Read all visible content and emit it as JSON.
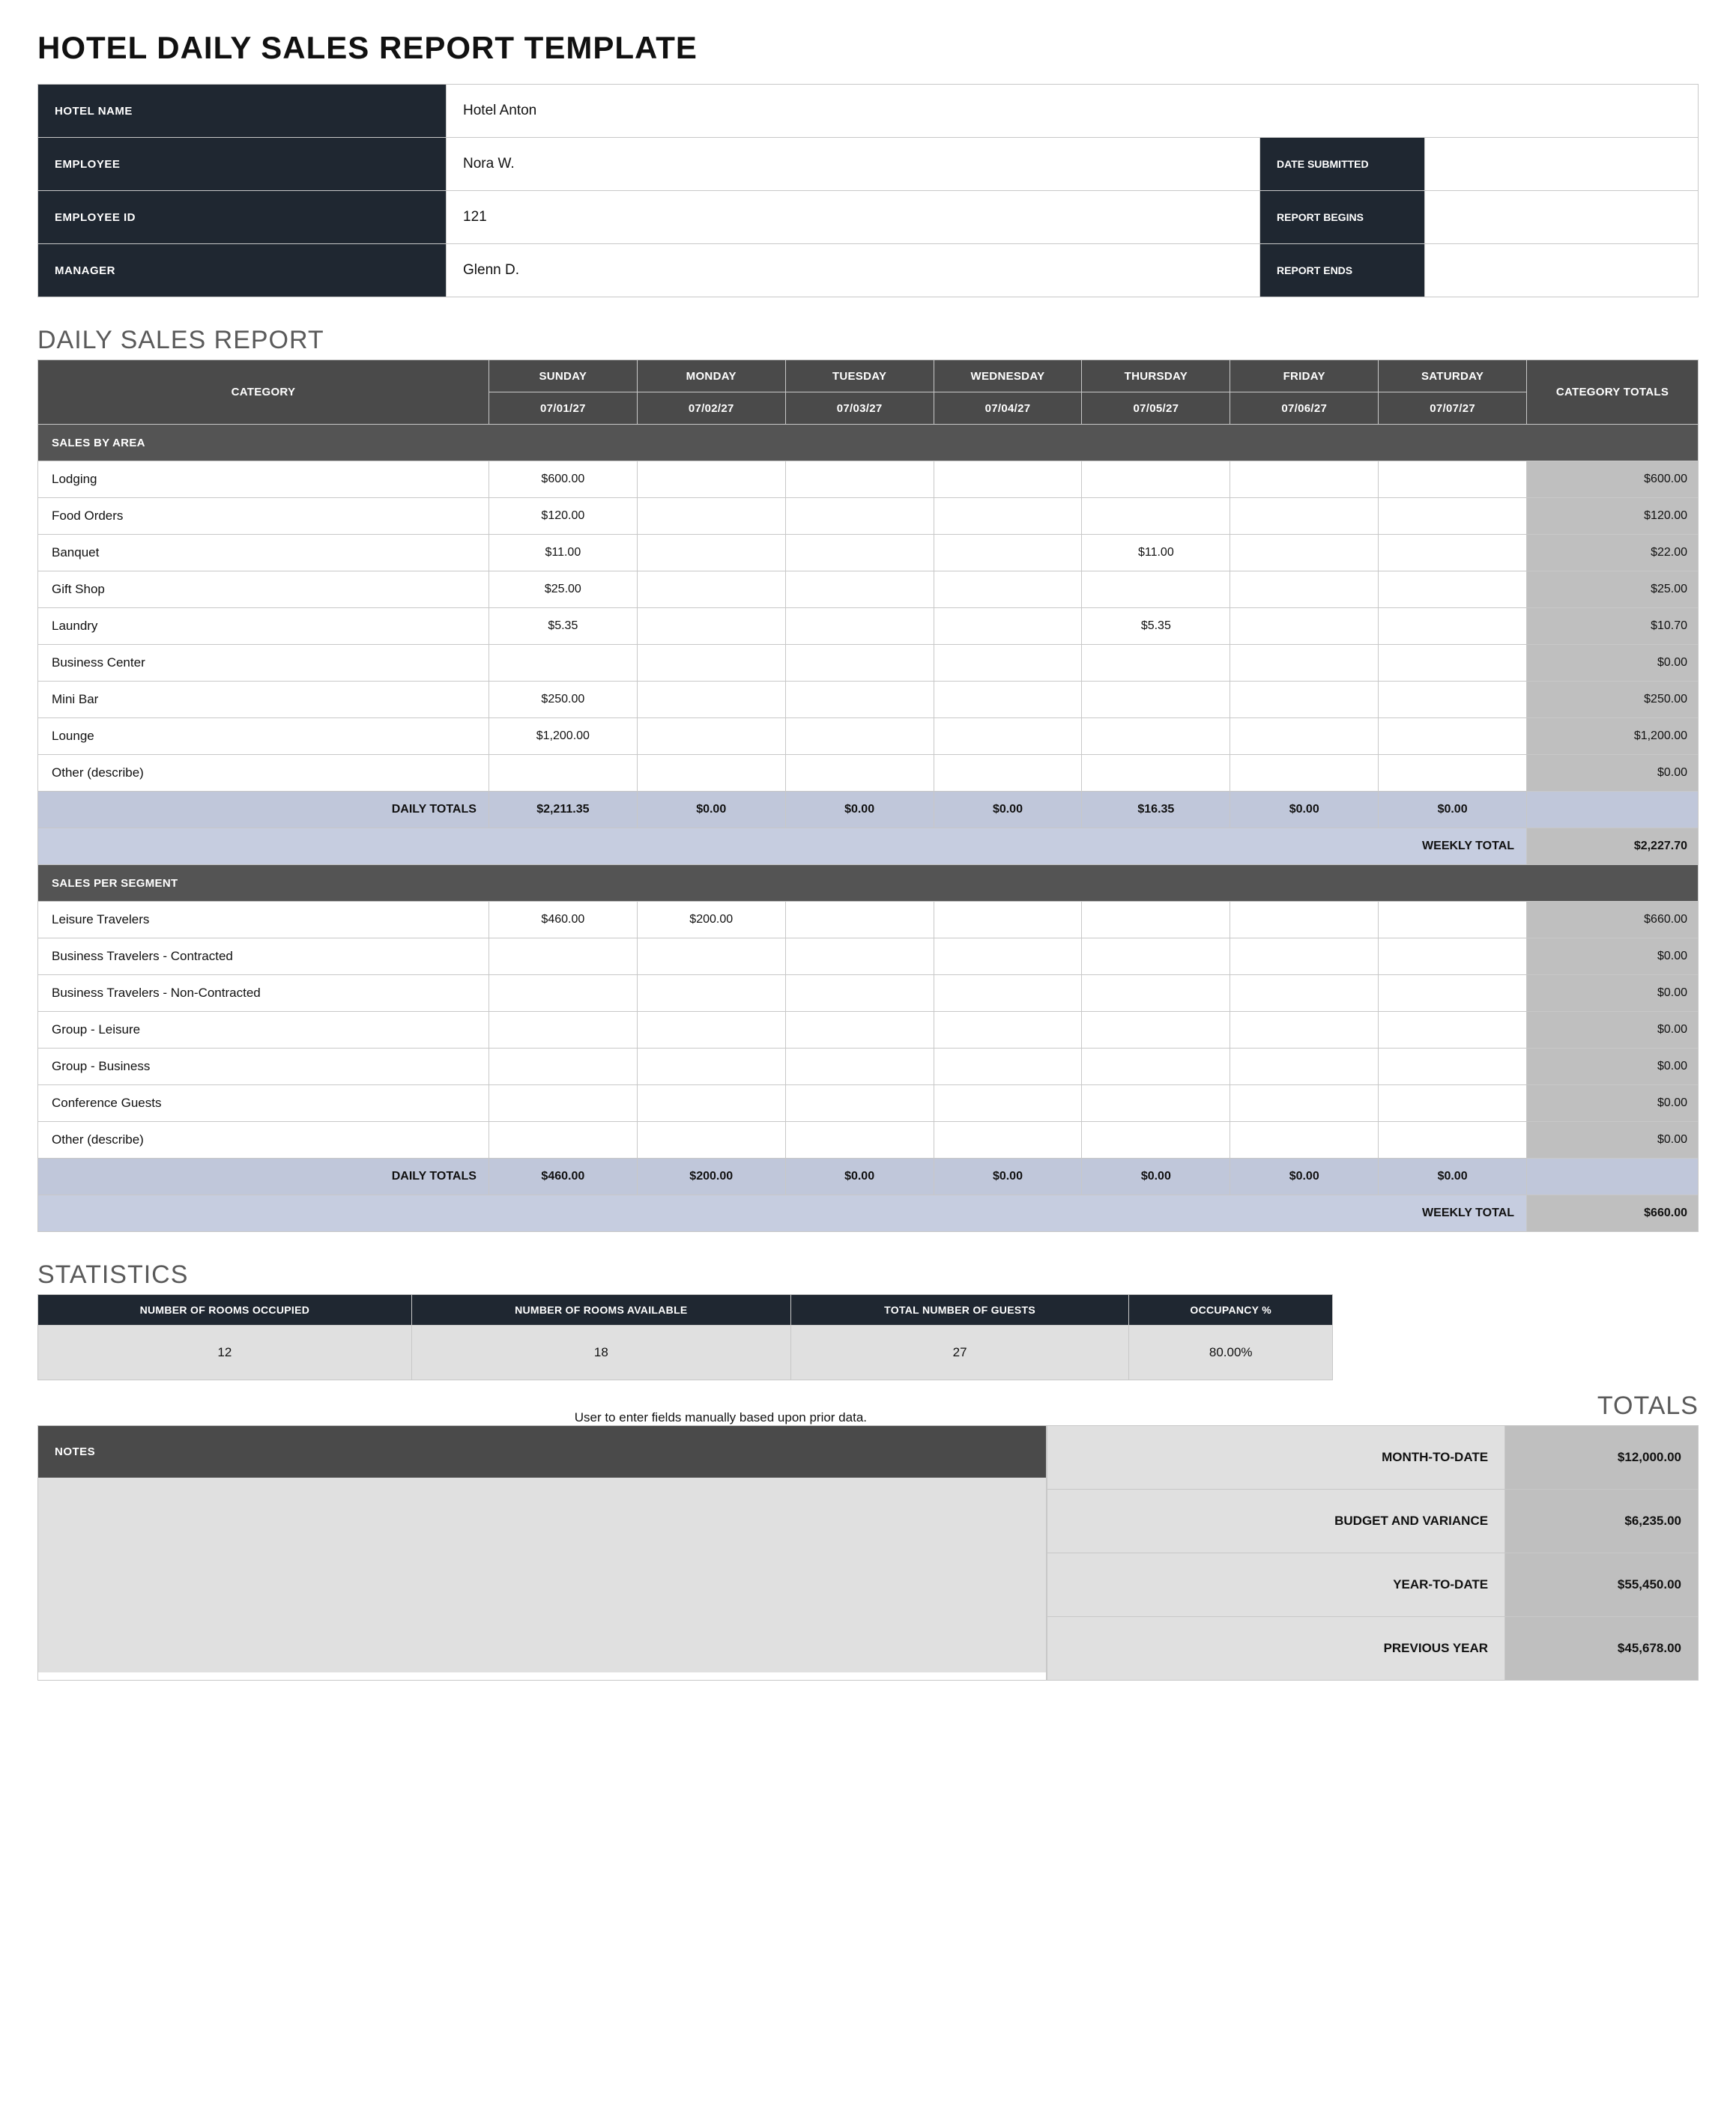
{
  "title": "HOTEL DAILY SALES REPORT TEMPLATE",
  "header": {
    "labels": {
      "hotel_name": "HOTEL NAME",
      "employee": "EMPLOYEE",
      "employee_id": "EMPLOYEE ID",
      "manager": "MANAGER",
      "date_submitted": "DATE SUBMITTED",
      "report_begins": "REPORT BEGINS",
      "report_ends": "REPORT ENDS"
    },
    "values": {
      "hotel_name": "Hotel Anton",
      "employee": "Nora W.",
      "employee_id": "121",
      "manager": "Glenn D.",
      "date_submitted": "",
      "report_begins": "",
      "report_ends": ""
    }
  },
  "report": {
    "section_title": "DAILY SALES REPORT",
    "col_category": "CATEGORY",
    "col_totals": "CATEGORY TOTALS",
    "days": [
      {
        "name": "SUNDAY",
        "date": "07/01/27"
      },
      {
        "name": "MONDAY",
        "date": "07/02/27"
      },
      {
        "name": "TUESDAY",
        "date": "07/03/27"
      },
      {
        "name": "WEDNESDAY",
        "date": "07/04/27"
      },
      {
        "name": "THURSDAY",
        "date": "07/05/27"
      },
      {
        "name": "FRIDAY",
        "date": "07/06/27"
      },
      {
        "name": "SATURDAY",
        "date": "07/07/27"
      }
    ],
    "section1": {
      "label": "SALES BY AREA",
      "rows": [
        {
          "label": "Lodging",
          "vals": [
            "$600.00",
            "",
            "",
            "",
            "",
            "",
            ""
          ],
          "total": "$600.00"
        },
        {
          "label": "Food Orders",
          "vals": [
            "$120.00",
            "",
            "",
            "",
            "",
            "",
            ""
          ],
          "total": "$120.00"
        },
        {
          "label": "Banquet",
          "vals": [
            "$11.00",
            "",
            "",
            "",
            "$11.00",
            "",
            ""
          ],
          "total": "$22.00"
        },
        {
          "label": "Gift Shop",
          "vals": [
            "$25.00",
            "",
            "",
            "",
            "",
            "",
            ""
          ],
          "total": "$25.00"
        },
        {
          "label": "Laundry",
          "vals": [
            "$5.35",
            "",
            "",
            "",
            "$5.35",
            "",
            ""
          ],
          "total": "$10.70"
        },
        {
          "label": "Business Center",
          "vals": [
            "",
            "",
            "",
            "",
            "",
            "",
            ""
          ],
          "total": "$0.00"
        },
        {
          "label": "Mini Bar",
          "vals": [
            "$250.00",
            "",
            "",
            "",
            "",
            "",
            ""
          ],
          "total": "$250.00"
        },
        {
          "label": "Lounge",
          "vals": [
            "$1,200.00",
            "",
            "",
            "",
            "",
            "",
            ""
          ],
          "total": "$1,200.00"
        },
        {
          "label": "Other (describe)",
          "vals": [
            "",
            "",
            "",
            "",
            "",
            "",
            ""
          ],
          "total": "$0.00"
        }
      ],
      "daily_totals_label": "DAILY TOTALS",
      "daily_totals": [
        "$2,211.35",
        "$0.00",
        "$0.00",
        "$0.00",
        "$16.35",
        "$0.00",
        "$0.00"
      ],
      "weekly_label": "WEEKLY TOTAL",
      "weekly_total": "$2,227.70"
    },
    "section2": {
      "label": "SALES PER SEGMENT",
      "rows": [
        {
          "label": "Leisure Travelers",
          "vals": [
            "$460.00",
            "$200.00",
            "",
            "",
            "",
            "",
            ""
          ],
          "total": "$660.00"
        },
        {
          "label": "Business Travelers - Contracted",
          "vals": [
            "",
            "",
            "",
            "",
            "",
            "",
            ""
          ],
          "total": "$0.00"
        },
        {
          "label": "Business Travelers - Non-Contracted",
          "vals": [
            "",
            "",
            "",
            "",
            "",
            "",
            ""
          ],
          "total": "$0.00"
        },
        {
          "label": "Group - Leisure",
          "vals": [
            "",
            "",
            "",
            "",
            "",
            "",
            ""
          ],
          "total": "$0.00"
        },
        {
          "label": "Group - Business",
          "vals": [
            "",
            "",
            "",
            "",
            "",
            "",
            ""
          ],
          "total": "$0.00"
        },
        {
          "label": "Conference Guests",
          "vals": [
            "",
            "",
            "",
            "",
            "",
            "",
            ""
          ],
          "total": "$0.00"
        },
        {
          "label": "Other (describe)",
          "vals": [
            "",
            "",
            "",
            "",
            "",
            "",
            ""
          ],
          "total": "$0.00"
        }
      ],
      "daily_totals_label": "DAILY TOTALS",
      "daily_totals": [
        "$460.00",
        "$200.00",
        "$0.00",
        "$0.00",
        "$0.00",
        "$0.00",
        "$0.00"
      ],
      "weekly_label": "WEEKLY TOTAL",
      "weekly_total": "$660.00"
    }
  },
  "statistics": {
    "section_title": "STATISTICS",
    "headers": [
      "NUMBER OF ROOMS OCCUPIED",
      "NUMBER OF ROOMS AVAILABLE",
      "TOTAL NUMBER OF GUESTS",
      "OCCUPANCY %"
    ],
    "values": [
      "12",
      "18",
      "27",
      "80.00%"
    ]
  },
  "footnote": "User to enter fields manually based upon prior data.",
  "totals": {
    "title": "TOTALS",
    "notes_label": "NOTES",
    "rows": [
      {
        "label": "MONTH-TO-DATE",
        "value": "$12,000.00"
      },
      {
        "label": "BUDGET AND VARIANCE",
        "value": "$6,235.00"
      },
      {
        "label": "YEAR-TO-DATE",
        "value": "$55,450.00"
      },
      {
        "label": "PREVIOUS YEAR",
        "value": "$45,678.00"
      }
    ]
  }
}
